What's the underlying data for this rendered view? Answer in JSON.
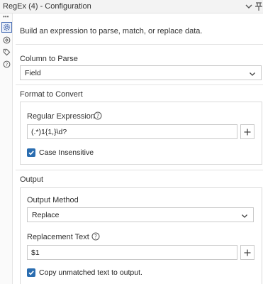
{
  "window": {
    "title": "RegEx (4) - Configuration"
  },
  "description": "Build an expression to parse, match, or replace data.",
  "column_to_parse": {
    "label": "Column to Parse",
    "value": "Field"
  },
  "format_to_convert": {
    "label": "Format to Convert",
    "regex_label": "Regular Expression",
    "regex_value": "(.*)1{1,}\\d?",
    "case_insensitive_label": "Case Insensitive",
    "case_insensitive_checked": true
  },
  "output": {
    "label": "Output",
    "method_label": "Output Method",
    "method_value": "Replace",
    "replacement_label": "Replacement Text",
    "replacement_value": "$1",
    "copy_unmatched_label": "Copy unmatched text to output.",
    "copy_unmatched_checked": true
  },
  "colors": {
    "accent": "#2a6db0",
    "border": "#c9c9c9"
  }
}
